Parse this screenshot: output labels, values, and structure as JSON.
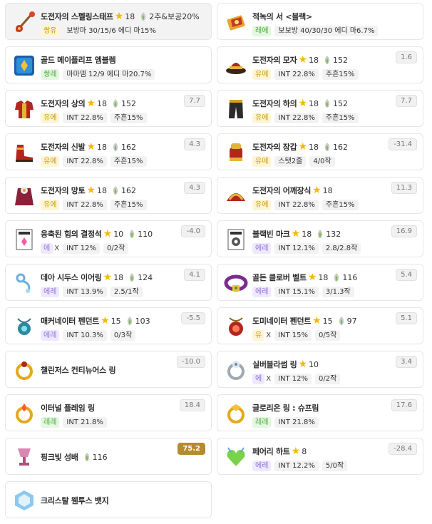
{
  "items": [
    {
      "id": "weapon",
      "name": "도전자의 스펠링스태프",
      "stars": "18",
      "flame": "2추&보공20%",
      "grade": "유니크",
      "grade_short": "쌍유",
      "grade_class": "unique",
      "stats": [
        "보방마 30/15/6 에디 마15%"
      ],
      "score": "",
      "icon": "staff-icon",
      "first": true
    },
    {
      "id": "secondary",
      "name": "적녹의 서 <블랙>",
      "grade": "레전드리",
      "grade_short": "레에",
      "grade_class": "legend",
      "stats": [
        "보보방 40/30/30 에디 마6.7%"
      ],
      "score": "",
      "icon": "book-icon"
    },
    {
      "id": "emblem",
      "name": "골드 메이플리프 엠블렘",
      "grade": "유니크",
      "grade_short": "쌍레",
      "grade_class": "legend",
      "stats": [
        "마마뎀 12/9 에디 마20.7%"
      ],
      "score": "",
      "icon": "emblem-icon"
    },
    {
      "id": "hat",
      "name": "도전자의 모자",
      "stars": "18",
      "flame": "152",
      "grade": "유니크",
      "grade_short": "유에",
      "grade_class": "unique",
      "stats": [
        "INT 22.8%",
        "주흔15%"
      ],
      "score": "1.6",
      "icon": "hat-icon"
    },
    {
      "id": "top",
      "name": "도전자의 상의",
      "stars": "18",
      "flame": "152",
      "grade_short": "유에",
      "grade_class": "unique",
      "stats": [
        "INT 22.8%",
        "주흔15%"
      ],
      "score": "7.7",
      "icon": "top-icon"
    },
    {
      "id": "bottom",
      "name": "도전자의 하의",
      "stars": "18",
      "flame": "152",
      "grade_short": "유에",
      "grade_class": "unique",
      "stats": [
        "INT 22.8%",
        "주흔15%"
      ],
      "score": "7.7",
      "icon": "bottom-icon"
    },
    {
      "id": "shoes",
      "name": "도전자의 신발",
      "stars": "18",
      "flame": "162",
      "grade_short": "유에",
      "grade_class": "unique",
      "stats": [
        "INT 22.8%",
        "주흔15%"
      ],
      "score": "4.3",
      "icon": "shoes-icon"
    },
    {
      "id": "gloves",
      "name": "도전자의 장갑",
      "stars": "18",
      "flame": "162",
      "grade_short": "유에",
      "grade_class": "unique",
      "stats": [
        "스탯2줄",
        "4/0작"
      ],
      "score": "-31.4",
      "icon": "gloves-icon"
    },
    {
      "id": "cape",
      "name": "도전자의 망토",
      "stars": "18",
      "flame": "162",
      "grade_short": "유에",
      "grade_class": "unique",
      "stats": [
        "INT 22.8%",
        "주흔15%"
      ],
      "score": "4.3",
      "icon": "cape-icon"
    },
    {
      "id": "shoulder",
      "name": "도전자의 어깨장식",
      "stars": "18",
      "grade_short": "유에",
      "grade_class": "unique",
      "stats": [
        "INT 22.8%",
        "주흔15%"
      ],
      "score": "11.3",
      "icon": "shoulder-icon"
    },
    {
      "id": "crystal",
      "name": "응축된 힘의 결정석",
      "stars": "10",
      "flame": "110",
      "grade_short": "에",
      "grade_class": "epic",
      "xmark": "X",
      "stats": [
        "INT 12%",
        "0/2작"
      ],
      "score": "-4.0",
      "icon": "crystal-card-icon"
    },
    {
      "id": "blackbean",
      "name": "블랙빈 마크",
      "stars": "18",
      "flame": "132",
      "grade_short": "에레",
      "grade_class": "epic",
      "stats": [
        "INT 12.1%",
        "2.8/2.8작"
      ],
      "score": "16.9",
      "icon": "mark-card-icon"
    },
    {
      "id": "earring",
      "name": "데아 시두스 이어링",
      "stars": "18",
      "flame": "124",
      "grade_short": "에레",
      "grade_class": "epic",
      "stats": [
        "INT 13.9%",
        "2.5/1작"
      ],
      "score": "4.1",
      "icon": "earring-icon"
    },
    {
      "id": "belt",
      "name": "골든 클로버 벨트",
      "stars": "18",
      "flame": "116",
      "grade_short": "에레",
      "grade_class": "epic",
      "stats": [
        "INT 15.1%",
        "3/1.3작"
      ],
      "score": "5.4",
      "icon": "belt-icon"
    },
    {
      "id": "pendant1",
      "name": "매커네이터 펜던트",
      "stars": "15",
      "flame": "103",
      "grade_short": "에레",
      "grade_class": "epic",
      "stats": [
        "INT 10.3%",
        "0/3작"
      ],
      "score": "-5.5",
      "icon": "pendant-icon"
    },
    {
      "id": "pendant2",
      "name": "도미네이터 펜던트",
      "stars": "15",
      "flame": "97",
      "grade_short": "유",
      "grade_class": "unique",
      "xmark": "X",
      "stats": [
        "INT 15%",
        "0/5작"
      ],
      "score": "5.1",
      "icon": "dominator-pendant-icon"
    },
    {
      "id": "ring1",
      "name": "챌린저스 컨티뉴어스 링",
      "score": "-10.0",
      "icon": "ring-icon"
    },
    {
      "id": "ring2",
      "name": "실버블라썸 링",
      "stars": "10",
      "grade_short": "에",
      "grade_class": "epic",
      "xmark": "X",
      "stats": [
        "INT 12%",
        "0/2작"
      ],
      "score": "3.4",
      "icon": "silver-ring-icon"
    },
    {
      "id": "ring3",
      "name": "이터널 플레임 링",
      "grade_short": "레레",
      "grade_class": "legend",
      "stats": [
        "INT 21.8%"
      ],
      "score": "18.4",
      "icon": "flame-ring-icon"
    },
    {
      "id": "ring4",
      "name": "글로리온 링 : 슈프림",
      "grade_short": "레레",
      "grade_class": "legend",
      "stats": [
        "INT 21.8%"
      ],
      "score": "17.6",
      "icon": "glory-ring-icon"
    },
    {
      "id": "pocket",
      "name": "핑크빛 성배",
      "flame": "116",
      "score": "75.2",
      "score_gold": true,
      "icon": "grail-icon"
    },
    {
      "id": "heart",
      "name": "페어리 하트",
      "stars": "8",
      "grade_short": "에레",
      "grade_class": "epic",
      "stats": [
        "INT 12.2%",
        "5/0작"
      ],
      "score": "-28.4",
      "icon": "heart-icon"
    },
    {
      "id": "badge",
      "name": "크리스탈 웬투스 뱃지",
      "icon": "badge-icon"
    }
  ]
}
